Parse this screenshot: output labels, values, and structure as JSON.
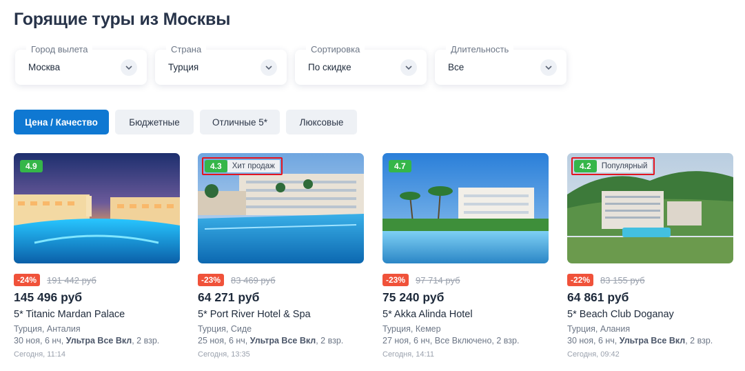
{
  "page": {
    "title": "Горящие туры из Москвы"
  },
  "filters": [
    {
      "label": "Город вылета",
      "value": "Москва"
    },
    {
      "label": "Страна",
      "value": "Турция"
    },
    {
      "label": "Сортировка",
      "value": "По скидке"
    },
    {
      "label": "Длительность",
      "value": "Все"
    }
  ],
  "tabs": [
    {
      "label": "Цена / Качество",
      "active": true
    },
    {
      "label": "Бюджетные",
      "active": false
    },
    {
      "label": "Отличные 5*",
      "active": false
    },
    {
      "label": "Люксовые",
      "active": false
    }
  ],
  "cards": [
    {
      "rating": "4.9",
      "badge": "",
      "discount": "-24%",
      "old_price": "191 442 руб",
      "price": "145 496 руб",
      "hotel": "5* Titanic Mardan Palace",
      "location": "Турция, Анталия",
      "dates_prefix": "30 ноя, 6 нч, ",
      "meal": "Ультра Все Вкл",
      "dates_suffix": ", 2 взр.",
      "updated": "Сегодня, 11:14"
    },
    {
      "rating": "4.3",
      "badge": "Хит продаж",
      "discount": "-23%",
      "old_price": "83 469 руб",
      "price": "64 271 руб",
      "hotel": "5* Port River Hotel & Spa",
      "location": "Турция, Сиде",
      "dates_prefix": "25 ноя, 6 нч, ",
      "meal": "Ультра Все Вкл",
      "dates_suffix": ", 2 взр.",
      "updated": "Сегодня, 13:35"
    },
    {
      "rating": "4.7",
      "badge": "",
      "discount": "-23%",
      "old_price": "97 714 руб",
      "price": "75 240 руб",
      "hotel": "5* Akka Alinda Hotel",
      "location": "Турция, Кемер",
      "dates_prefix": "27 ноя, 6 нч, Все Включено, 2 взр.",
      "meal": "",
      "dates_suffix": "",
      "updated": "Сегодня, 14:11"
    },
    {
      "rating": "4.2",
      "badge": "Популярный",
      "discount": "-22%",
      "old_price": "83 155 руб",
      "price": "64 861 руб",
      "hotel": "5* Beach Club Doganay",
      "location": "Турция, Алания",
      "dates_prefix": "30 ноя, 6 нч, ",
      "meal": "Ультра Все Вкл",
      "dates_suffix": ", 2 взр.",
      "updated": "Сегодня, 09:42"
    }
  ],
  "colors": {
    "accent": "#0f78d2",
    "rating": "#35b649",
    "discount": "#f0523a",
    "highlight_border": "#e3141f"
  }
}
